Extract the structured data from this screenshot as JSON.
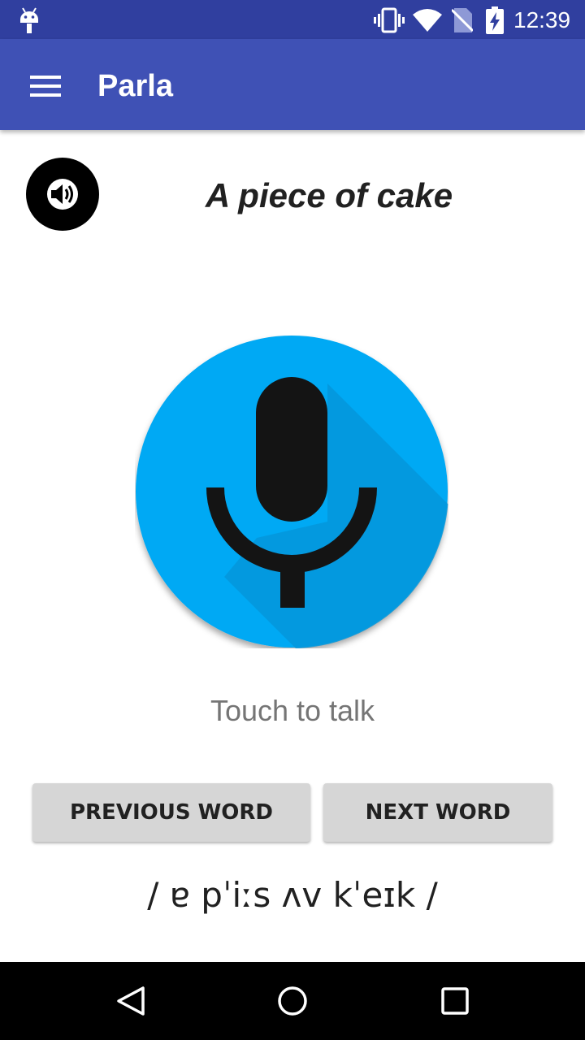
{
  "status_bar": {
    "time": "12:39",
    "icons": [
      "android-icon",
      "vibrate-icon",
      "wifi-icon",
      "no-sim-icon",
      "battery-charging-icon"
    ]
  },
  "app_bar": {
    "title": "Parla",
    "menu_icon": "menu-icon"
  },
  "main": {
    "speaker_icon": "speaker-icon",
    "phrase": "A piece of cake",
    "mic_icon": "microphone-icon",
    "touch_label": "Touch to talk",
    "previous_button_label": "PREVIOUS WORD",
    "next_button_label": "NEXT WORD",
    "pronunciation": "/ ɐ pˈiːs ʌv kˈeɪk /"
  },
  "nav_bar": {
    "icons": [
      "back-icon",
      "home-icon",
      "recent-apps-icon"
    ]
  },
  "colors": {
    "status_bar": "#303f9f",
    "app_bar": "#3f51b5",
    "mic_button": "#03a9f4"
  }
}
